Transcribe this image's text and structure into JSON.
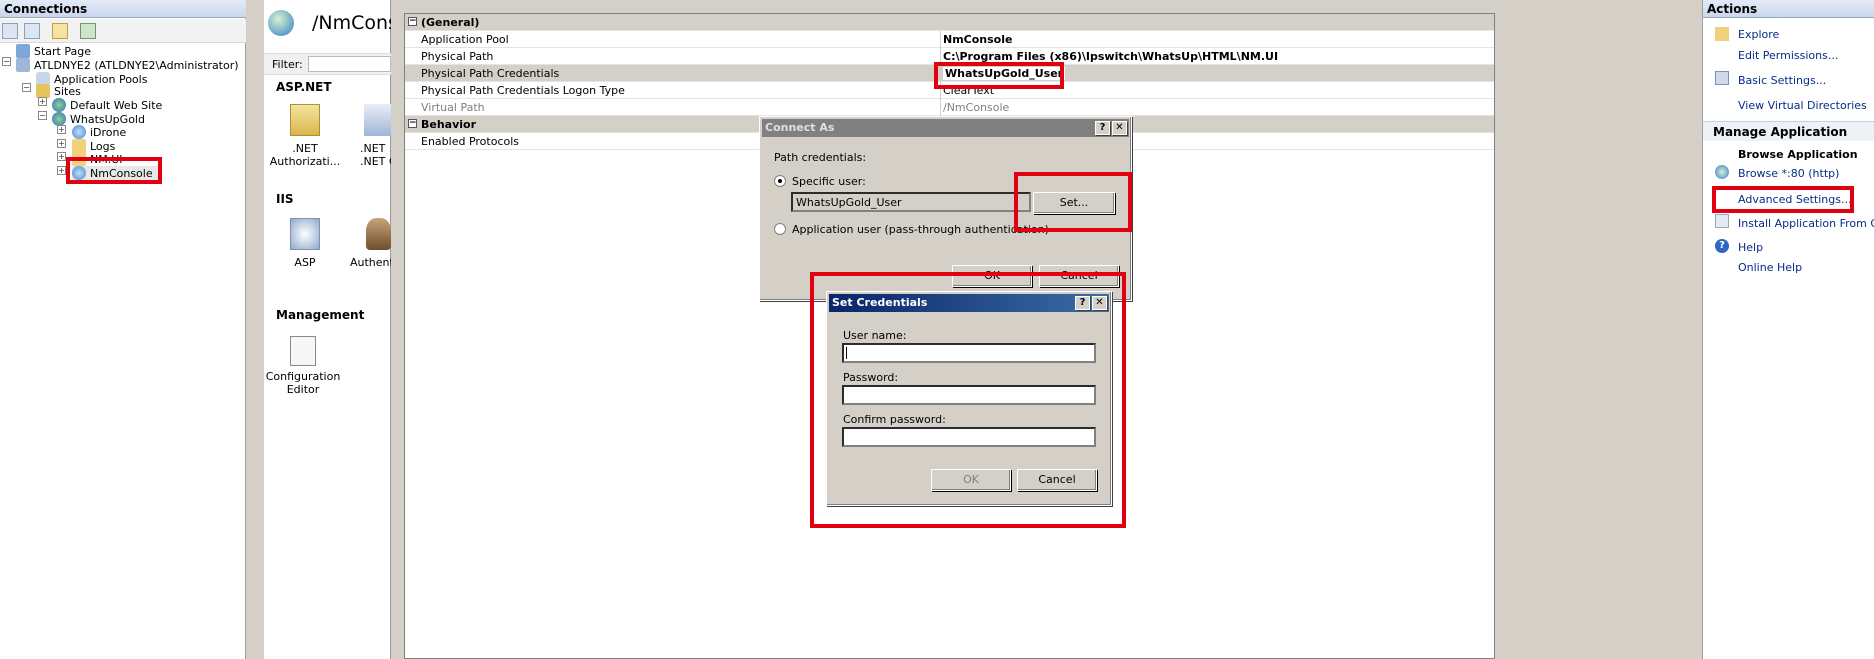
{
  "connections": {
    "header": "Connections",
    "tree": [
      {
        "label": "Start Page"
      },
      {
        "label": "ATLDNYE2 (ATLDNYE2\\Administrator)"
      },
      {
        "label": "Application Pools"
      },
      {
        "label": "Sites"
      },
      {
        "label": "Default Web Site"
      },
      {
        "label": "WhatsUpGold"
      },
      {
        "label": "iDrone"
      },
      {
        "label": "Logs"
      },
      {
        "label": "NM.UI"
      },
      {
        "label": "NmConsole"
      }
    ]
  },
  "features": {
    "title": "/NmCons",
    "filter_label": "Filter:",
    "sections": [
      {
        "name": "ASP.NET",
        "items": [
          ".NET Authorizati...",
          ".NET Compila"
        ]
      },
      {
        "name": "IIS",
        "items": [
          "ASP",
          "Authentic"
        ]
      },
      {
        "name": "Management",
        "items": [
          "Configuration Editor"
        ]
      }
    ]
  },
  "propgrid": {
    "categories": [
      {
        "name": "(General)",
        "rows": [
          {
            "key": "Application Pool",
            "value": "NmConsole"
          },
          {
            "key": "Physical Path",
            "value": "C:\\Program Files (x86)\\Ipswitch\\WhatsUp\\HTML\\NM.UI"
          },
          {
            "key": "Physical Path Credentials",
            "value": "WhatsUpGold_User"
          },
          {
            "key": "Physical Path Credentials Logon Type",
            "value": "ClearText"
          },
          {
            "key": "Virtual Path",
            "value": "/NmConsole"
          }
        ]
      },
      {
        "name": "Behavior",
        "rows": [
          {
            "key": "Enabled Protocols",
            "value": ""
          }
        ]
      }
    ]
  },
  "connect_as": {
    "title": "Connect As",
    "path_credentials_label": "Path credentials:",
    "specific_user_label": "Specific user:",
    "specific_user_value": "WhatsUpGold_User",
    "set_button": "Set...",
    "app_user_label": "Application user (pass-through authentication)",
    "ok_button": "OK",
    "cancel_button": "Cancel"
  },
  "set_credentials": {
    "title": "Set Credentials",
    "username_label": "User name:",
    "password_label": "Password:",
    "confirm_label": "Confirm password:",
    "ok_button": "OK",
    "cancel_button": "Cancel"
  },
  "actions": {
    "header": "Actions",
    "items": [
      {
        "label": "Explore"
      },
      {
        "label": "Edit Permissions..."
      },
      {
        "label": "Basic Settings..."
      },
      {
        "label": "View Virtual Directories"
      }
    ],
    "manage_header": "Manage Application",
    "browse_header": "Browse Application",
    "browse_link": "Browse *:80 (http)",
    "advanced_settings": "Advanced Settings...",
    "install_gallery": "Install Application From Galle",
    "help": "Help",
    "online_help": "Online Help"
  },
  "colors": {
    "title_active": "#0a246a",
    "title_inactive": "#808080",
    "highlight_red": "#e00010",
    "link_blue": "#062c87"
  }
}
